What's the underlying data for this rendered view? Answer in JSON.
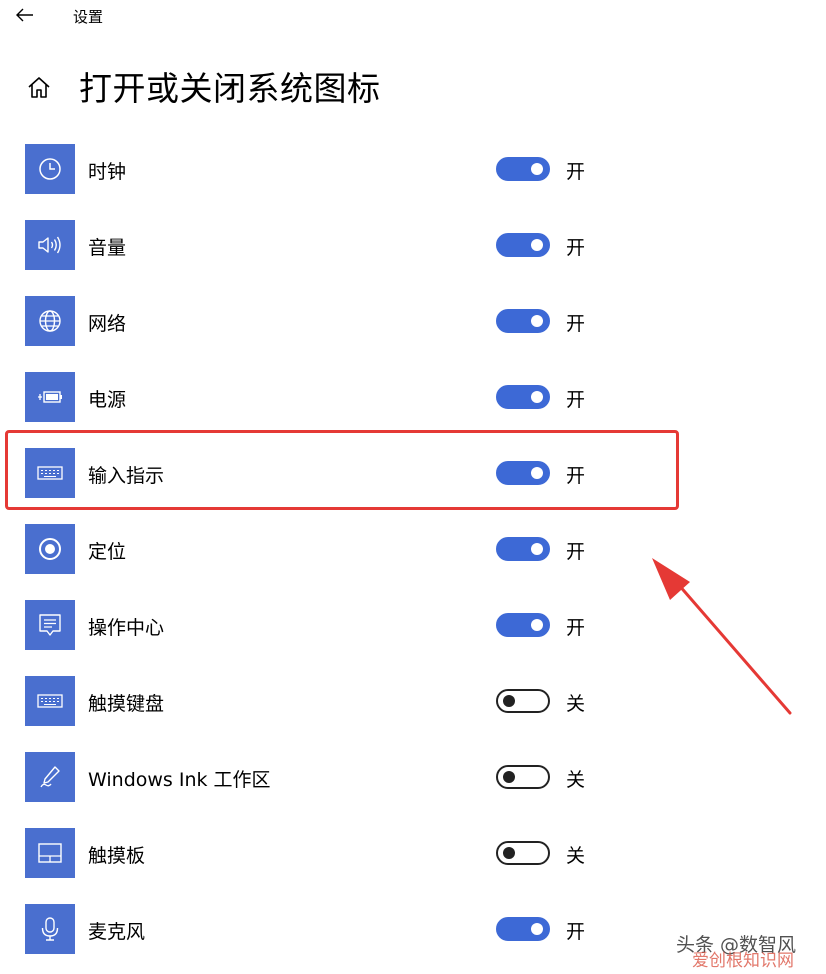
{
  "app": {
    "title": "设置",
    "back_icon": "back-arrow-icon",
    "home_icon": "home-icon"
  },
  "page": {
    "title": "打开或关闭系统图标"
  },
  "colors": {
    "accent": "#3d69d6",
    "icon_tile": "#4a6fcf",
    "highlight": "#e53935"
  },
  "items": [
    {
      "label": "时钟",
      "icon": "clock-icon",
      "on": true,
      "state": "开"
    },
    {
      "label": "音量",
      "icon": "volume-icon",
      "on": true,
      "state": "开"
    },
    {
      "label": "网络",
      "icon": "globe-icon",
      "on": true,
      "state": "开"
    },
    {
      "label": "电源",
      "icon": "battery-icon",
      "on": true,
      "state": "开"
    },
    {
      "label": "输入指示",
      "icon": "keyboard-icon",
      "on": true,
      "state": "开"
    },
    {
      "label": "定位",
      "icon": "location-icon",
      "on": true,
      "state": "开"
    },
    {
      "label": "操作中心",
      "icon": "action-center-icon",
      "on": true,
      "state": "开"
    },
    {
      "label": "触摸键盘",
      "icon": "touch-keyboard-icon",
      "on": false,
      "state": "关"
    },
    {
      "label": "Windows Ink 工作区",
      "icon": "pen-icon",
      "on": false,
      "state": "关"
    },
    {
      "label": "触摸板",
      "icon": "touchpad-icon",
      "on": false,
      "state": "关"
    },
    {
      "label": "麦克风",
      "icon": "microphone-icon",
      "on": true,
      "state": "开"
    }
  ],
  "watermark": {
    "line1": "头条 @数智风",
    "line2": "爱创根知识网"
  }
}
